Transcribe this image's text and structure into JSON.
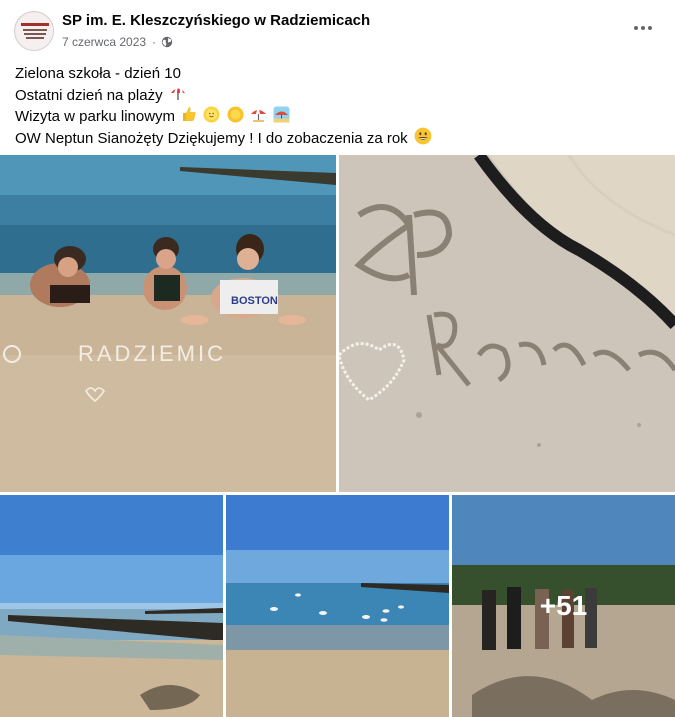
{
  "header": {
    "page_name": "SP im. E. Kleszczyńskiego w Radziemicach",
    "date": "7 czerwca 2023",
    "visibility_icon": "globe-icon",
    "more_icon": "more-options-icon",
    "avatar_text": [
      "SZKOŁA PODSTAWOWA",
      "im. Edwarda Kleszczyńskiego",
      "w RADZIEMICACH"
    ]
  },
  "post": {
    "line1": "Zielona szkoła - dzień 10",
    "line2": "Ostatni dzień na plaży",
    "line3": "Wizyta w parku linowym",
    "line4": "OW Neptun Sianożęty Dziękujemy ! I do zobaczenia za rok"
  },
  "photos": {
    "photo1_sand_text": "RADZIEMIC",
    "photo1_shirt_text": "BOSTON",
    "more_count": "+51"
  },
  "colors": {
    "sea": "#2f6e8e",
    "sky": "#5b9ad6",
    "sand": "#cdb59a",
    "muted": "#65676b"
  }
}
